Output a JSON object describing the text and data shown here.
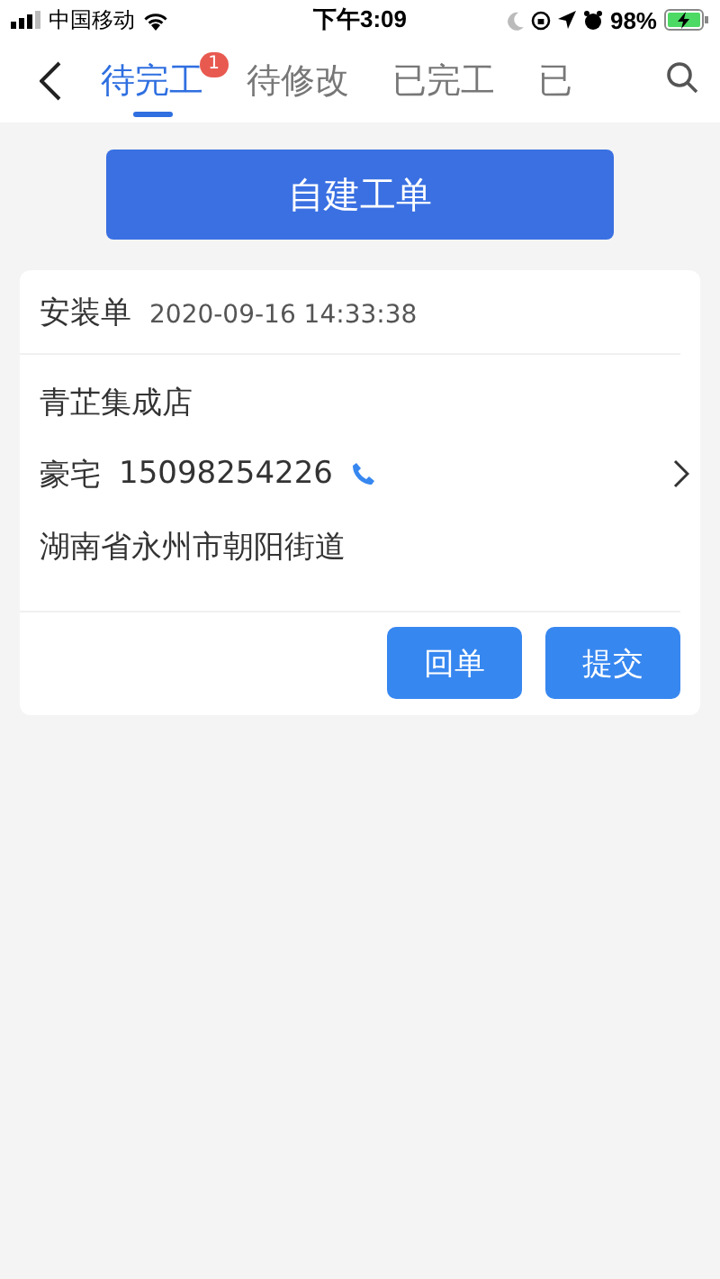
{
  "status_bar": {
    "carrier": "中国移动",
    "time": "下午3:09",
    "battery": "98%"
  },
  "tabs": [
    {
      "label": "待完工",
      "selected": true,
      "badge": "1"
    },
    {
      "label": "待修改",
      "selected": false
    },
    {
      "label": "已完工",
      "selected": false
    },
    {
      "label": "已",
      "selected": false
    }
  ],
  "create_button": "自建工单",
  "orders": [
    {
      "type": "安装单",
      "datetime": "2020-09-16 14:33:38",
      "store": "青芷集成店",
      "customer": "豪宅",
      "phone": "15098254226",
      "address": "湖南省永州市朝阳街道",
      "buttons": [
        "回单",
        "提交"
      ]
    }
  ]
}
